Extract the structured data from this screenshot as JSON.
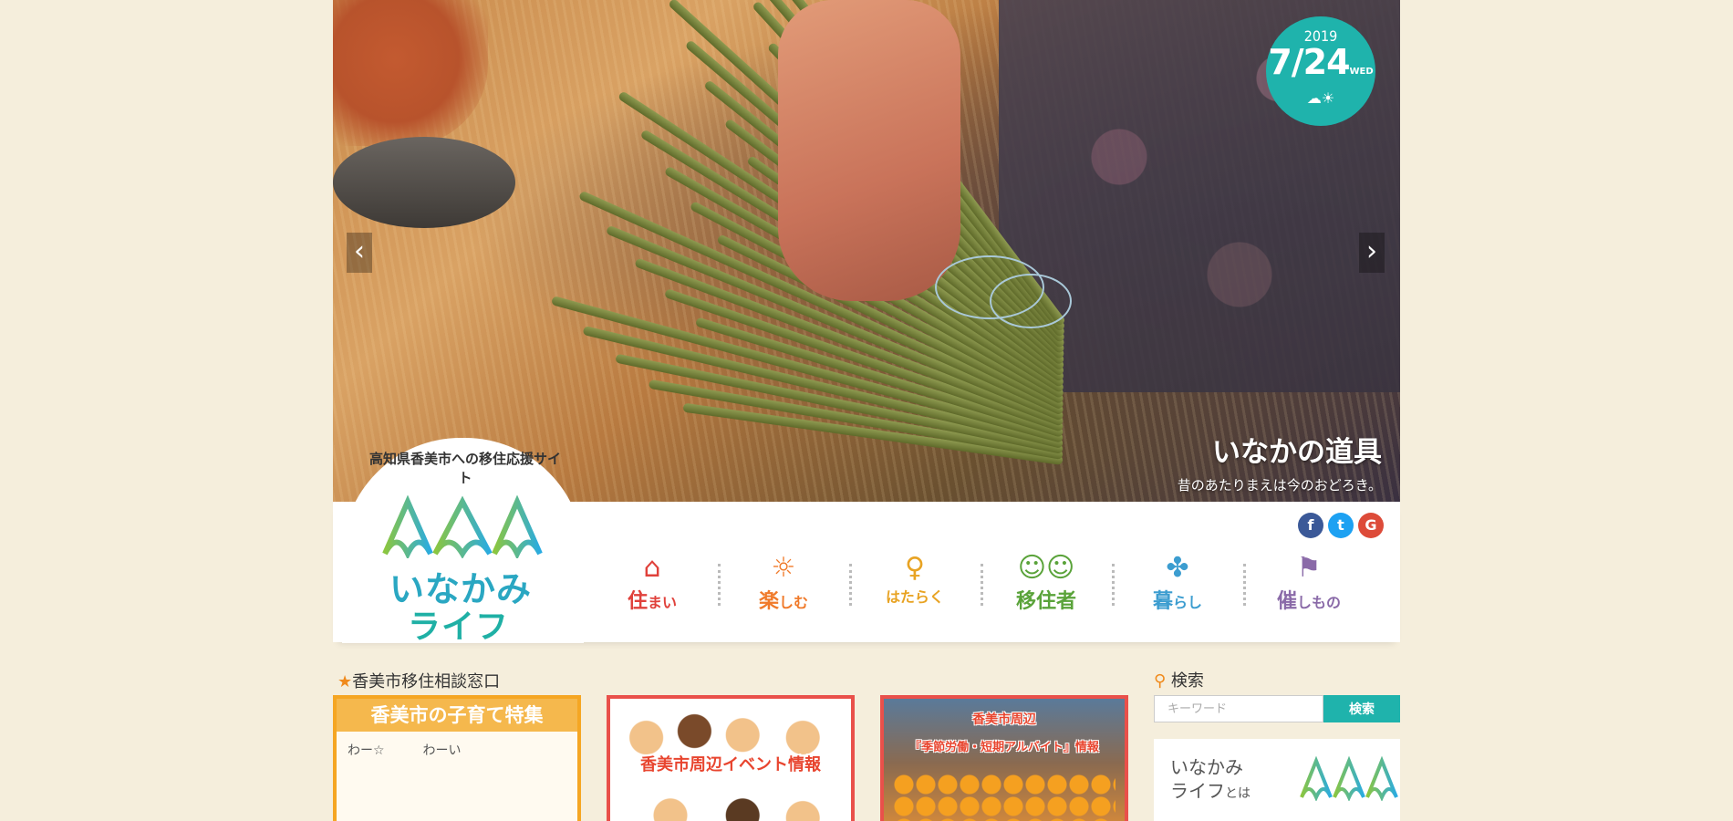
{
  "hero": {
    "date": {
      "year": "2019",
      "month_day": "7/24",
      "weekday": "WED",
      "weather_icon": "cloud-sun-icon"
    },
    "caption_title": "いなかの道具",
    "caption_sub": "昔のあたりまえは今のおどろき。",
    "prev_arrow": "‹",
    "next_arrow": "›"
  },
  "logo": {
    "tagline": "高知県香美市への移住応援サイト",
    "name_line1": "いなかみ",
    "name_line2": "ライフ"
  },
  "social": [
    {
      "name": "facebook",
      "glyph": "f",
      "color": "#3b5998"
    },
    {
      "name": "twitter",
      "glyph": "t",
      "color": "#1da1f2"
    },
    {
      "name": "google",
      "glyph": "G",
      "color": "#dd4b39"
    }
  ],
  "nav": [
    {
      "icon": "house-icon",
      "glyph": "⌂",
      "big": "住",
      "small": "まい",
      "color": "#e0413b"
    },
    {
      "icon": "sun-icon",
      "glyph": "☼",
      "big": "楽",
      "small": "しむ",
      "color": "#f07a2a"
    },
    {
      "icon": "person-icon",
      "glyph": "♀",
      "big": "",
      "small": "はたらく",
      "color": "#e8a323"
    },
    {
      "icon": "faces-icon",
      "glyph": "☺☺",
      "big": "移住者",
      "small": "",
      "color": "#5aa33a"
    },
    {
      "icon": "clover-icon",
      "glyph": "✤",
      "big": "暮",
      "small": "らし",
      "color": "#3c9dd0"
    },
    {
      "icon": "flag-icon",
      "glyph": "⚑",
      "big": "催",
      "small": "しもの",
      "color": "#8a6aa8"
    }
  ],
  "section": {
    "title": "香美市移住相談窓口",
    "cards": [
      {
        "title": "香美市の子育て特集",
        "doodle": "わー☆　　　わーい"
      },
      {
        "title": "香美市周辺イベント情報"
      },
      {
        "title_top": "香美市周辺",
        "title_bottom": "『季節労働・短期アルバイト』情報"
      }
    ]
  },
  "search": {
    "title": "検索",
    "placeholder": "キーワード",
    "button": "検索"
  },
  "about": {
    "line1": "いなかみ",
    "line2": "ライフ",
    "line2_small": "とは"
  },
  "colors": {
    "teal": "#1fb3ac",
    "background": "#f5eedc",
    "accent_orange": "#f08a1c"
  }
}
